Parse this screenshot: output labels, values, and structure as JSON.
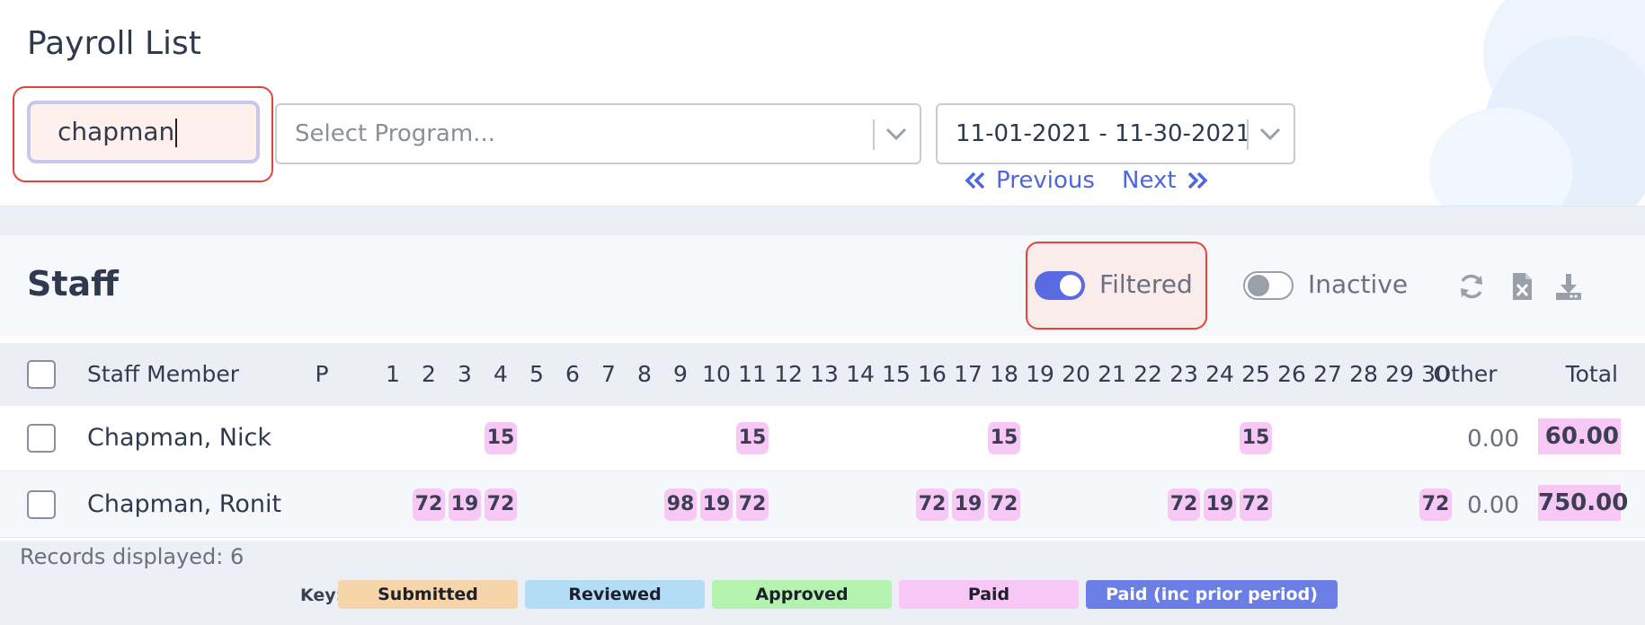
{
  "page": {
    "title": "Payroll List"
  },
  "filters": {
    "search_value": "chapman",
    "program_placeholder": "Select Program...",
    "date_range": "11-01-2021 - 11-30-2021",
    "previous_label": "Previous",
    "next_label": "Next"
  },
  "staff": {
    "title": "Staff",
    "filtered_label": "Filtered",
    "filtered_on": true,
    "inactive_label": "Inactive",
    "inactive_on": false,
    "icons": [
      "refresh-icon",
      "excel-export-icon",
      "download-icon"
    ]
  },
  "table": {
    "columns": {
      "staff_member": "Staff Member",
      "p": "P",
      "days": [
        "1",
        "2",
        "3",
        "4",
        "5",
        "6",
        "7",
        "8",
        "9",
        "10",
        "11",
        "12",
        "13",
        "14",
        "15",
        "16",
        "17",
        "18",
        "19",
        "20",
        "21",
        "22",
        "23",
        "24",
        "25",
        "26",
        "27",
        "28",
        "29",
        "30"
      ],
      "other": "Other",
      "total": "Total"
    },
    "rows": [
      {
        "name": "Chapman, Nick",
        "entries": {
          "4": "15",
          "11": "15",
          "18": "15",
          "25": "15"
        },
        "other": "0.00",
        "total": "60.00"
      },
      {
        "name": "Chapman, Ronit",
        "entries": {
          "2": "72",
          "3": "19",
          "4": "72",
          "9": "98",
          "10": "19",
          "11": "72",
          "16": "72",
          "17": "19",
          "18": "72",
          "23": "72",
          "24": "19",
          "25": "72",
          "30": "72"
        },
        "other": "0.00",
        "total": "750.00"
      }
    ]
  },
  "footer": {
    "records_displayed": "Records displayed: 6",
    "key_label": "Key:",
    "key_items": [
      {
        "label": "Submitted",
        "color": "#f6d5ab",
        "text_color": "#1d1f2a"
      },
      {
        "label": "Reviewed",
        "color": "#b3dcf5",
        "text_color": "#1d1f2a"
      },
      {
        "label": "Approved",
        "color": "#b4f2b0",
        "text_color": "#1d1f2a"
      },
      {
        "label": "Paid",
        "color": "#f7c8f5",
        "text_color": "#1d1f2a"
      },
      {
        "label": "Paid (inc prior period)",
        "color": "#6b7ee6",
        "text_color": "#ffffff"
      }
    ]
  },
  "colors": {
    "accent": "#4e66e0",
    "highlight": "#e2463a",
    "paid": "#f7c8f5"
  }
}
